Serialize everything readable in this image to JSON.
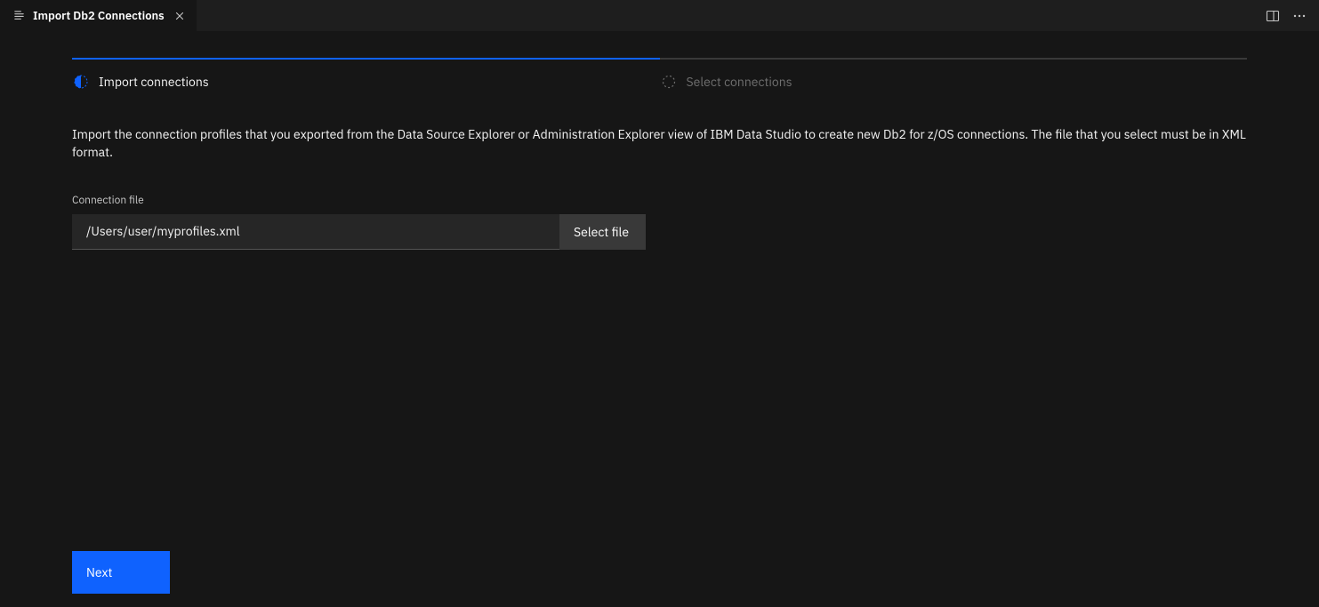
{
  "tab": {
    "title": "Import Db2 Connections"
  },
  "steps": {
    "active": {
      "label": "Import connections"
    },
    "inactive": {
      "label": "Select connections"
    }
  },
  "description": "Import the connection profiles that you exported from the Data Source Explorer or Administration Explorer view of IBM Data Studio to create new Db2 for z/OS connections. The file that you select must be in XML format.",
  "form": {
    "connection_file_label": "Connection file",
    "connection_file_value": "/Users/user/myprofiles.xml",
    "select_file_label": "Select file"
  },
  "footer": {
    "next_label": "Next"
  }
}
